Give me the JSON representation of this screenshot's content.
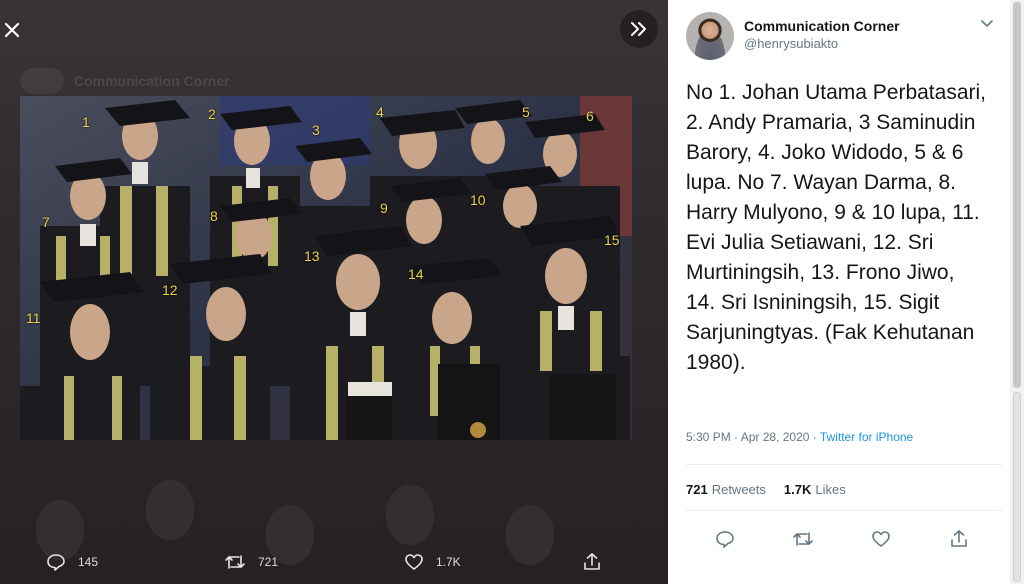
{
  "viewer": {
    "ghost_author": "Communication Corner",
    "close_icon": "close-icon",
    "expand_icon": "double-chevron-right-icon",
    "labels": [
      "1",
      "2",
      "3",
      "4",
      "5",
      "6",
      "7",
      "8",
      "9",
      "10",
      "11",
      "12",
      "13",
      "14",
      "15"
    ],
    "label_color": "#e8d34a",
    "actions": {
      "reply_count": "145",
      "retweet_count": "721",
      "like_count": "1.7K"
    }
  },
  "tweet": {
    "display_name": "Communication Corner",
    "handle": "@henrysubiakto",
    "text": "No 1. Johan Utama Perbatasari, 2. Andy Pramaria, 3 Saminudin Barory, 4. Joko Widodo, 5 & 6 lupa. No 7. Wayan Darma, 8. Harry Mulyono, 9 & 10 lupa, 11. Evi Julia Setiawani, 12. Sri Murtiningsih, 13. Frono Jiwo, 14. Sri Isniningsih, 15. Sigit Sarjuningtyas. (Fak Kehutanan 1980).",
    "timestamp": "5:30 PM · Apr 28, 2020 · ",
    "source": "Twitter for iPhone",
    "retweets_value": "721",
    "retweets_label": "Retweets",
    "likes_value": "1.7K",
    "likes_label": "Likes"
  },
  "colors": {
    "link": "#1b95e0",
    "text": "#14171a",
    "muted": "#657786"
  }
}
